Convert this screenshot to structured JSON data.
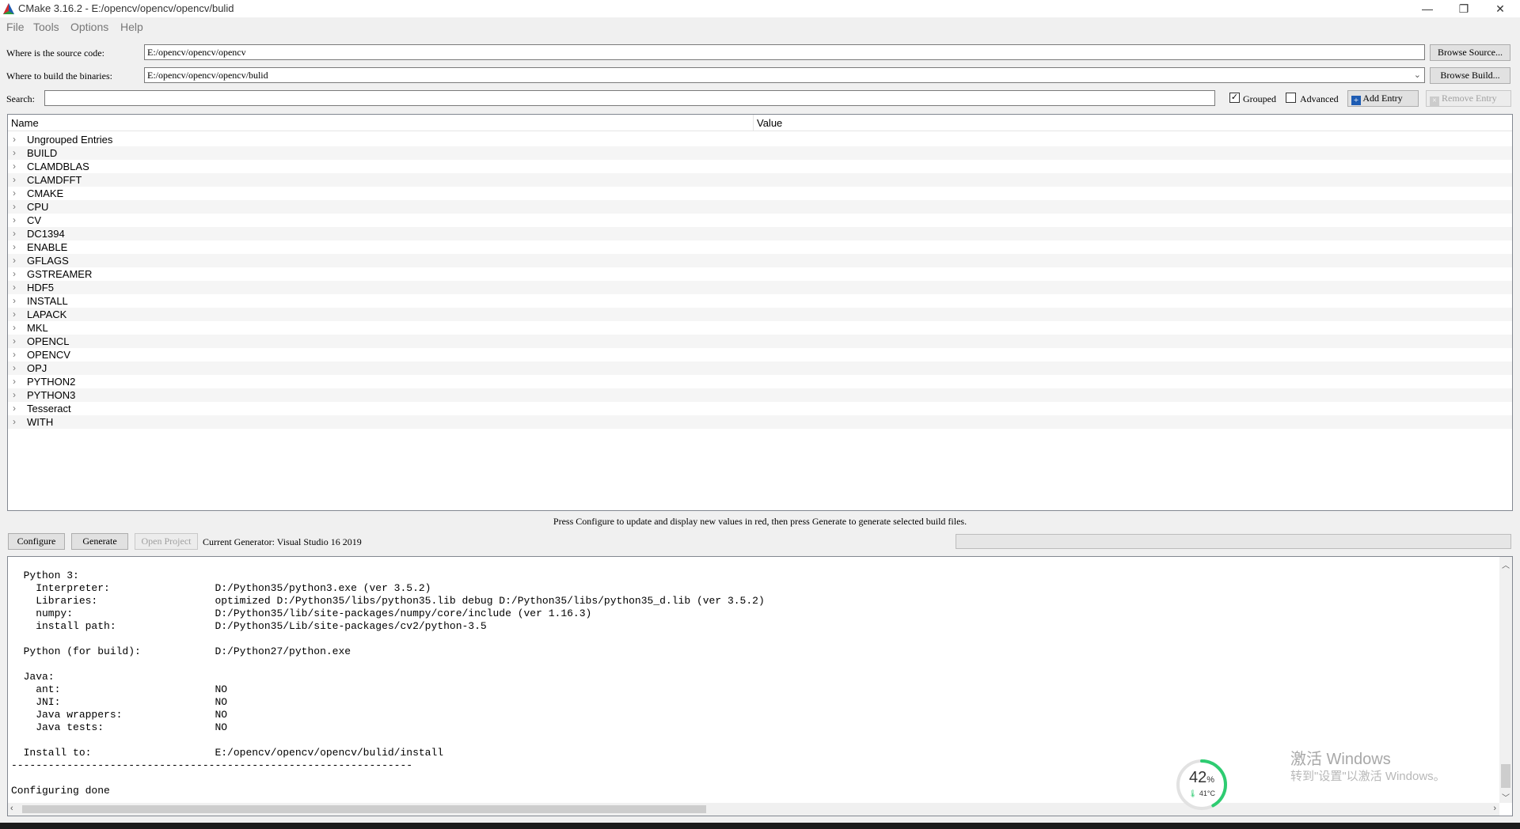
{
  "window": {
    "title": "CMake 3.16.2 - E:/opencv/opencv/opencv/bulid",
    "minimize_glyph": "—",
    "maximize_glyph": "❐",
    "close_glyph": "✕"
  },
  "menu": [
    "File",
    "Tools",
    "Options",
    "Help"
  ],
  "source": {
    "label": "Where is the source code:",
    "value": "E:/opencv/opencv/opencv",
    "button": "Browse Source..."
  },
  "build": {
    "label": "Where to build the binaries:",
    "value": "E:/opencv/opencv/opencv/bulid",
    "button": "Browse Build..."
  },
  "search": {
    "label": "Search:",
    "value": "",
    "grouped_label": "Grouped",
    "grouped_checked": true,
    "advanced_label": "Advanced",
    "advanced_checked": false,
    "add_entry": "Add Entry",
    "remove_entry": "Remove Entry"
  },
  "tree": {
    "col_name": "Name",
    "col_value": "Value",
    "rows": [
      "Ungrouped Entries",
      "BUILD",
      "CLAMDBLAS",
      "CLAMDFFT",
      "CMAKE",
      "CPU",
      "CV",
      "DC1394",
      "ENABLE",
      "GFLAGS",
      "GSTREAMER",
      "HDF5",
      "INSTALL",
      "LAPACK",
      "MKL",
      "OPENCL",
      "OPENCV",
      "OPJ",
      "PYTHON2",
      "PYTHON3",
      "Tesseract",
      "WITH"
    ]
  },
  "hint": "Press Configure to update and display new values in red, then press Generate to generate selected build files.",
  "actions": {
    "configure": "Configure",
    "generate": "Generate",
    "open_project": "Open Project",
    "generator": "Current Generator: Visual Studio 16 2019",
    "progress": 0
  },
  "output_lines": [
    "  Python 3:",
    "    Interpreter:                 D:/Python35/python3.exe (ver 3.5.2)",
    "    Libraries:                   optimized D:/Python35/libs/python35.lib debug D:/Python35/libs/python35_d.lib (ver 3.5.2)",
    "    numpy:                       D:/Python35/lib/site-packages/numpy/core/include (ver 1.16.3)",
    "    install path:                D:/Python35/Lib/site-packages/cv2/python-3.5",
    "",
    "  Python (for build):            D:/Python27/python.exe",
    "",
    "  Java:",
    "    ant:                         NO",
    "    JNI:                         NO",
    "    Java wrappers:               NO",
    "    Java tests:                  NO",
    "",
    "  Install to:                    E:/opencv/opencv/opencv/bulid/install",
    "-----------------------------------------------------------------",
    "",
    "Configuring done"
  ],
  "widget": {
    "percent": "42",
    "percent_sign": "%",
    "temp": "41°C",
    "level": 0.42,
    "color": "#2ecc71"
  },
  "watermark": {
    "line1": "激活 Windows",
    "line2": "转到\"设置\"以激活 Windows。"
  }
}
